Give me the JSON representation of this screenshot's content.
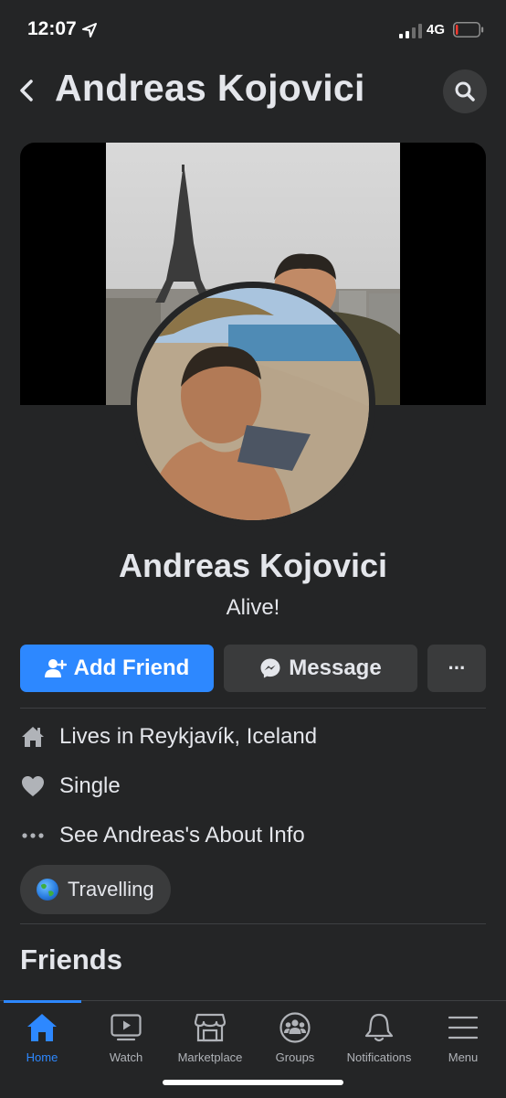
{
  "status_bar": {
    "time": "12:07",
    "network": "4G",
    "location_icon": "location-arrow-icon",
    "battery_level": 0.1,
    "battery_color": "#ff3b30"
  },
  "header": {
    "back_icon": "chevron-left-icon",
    "title": "Andreas Kojovici",
    "search_icon": "search-icon"
  },
  "profile": {
    "name": "Andreas Kojovici",
    "bio": "Alive!"
  },
  "actions": {
    "add_friend": "Add Friend",
    "message": "Message",
    "more": "···"
  },
  "intro": {
    "lives_prefix": "Lives in",
    "lives_place": "Reykjavík, Iceland",
    "relationship": "Single",
    "about": "See Andreas's About Info"
  },
  "featured_chip": {
    "emoji_icon": "globe-icon",
    "label": "Travelling"
  },
  "friends_section": {
    "title": "Friends"
  },
  "tabbar": {
    "items": [
      {
        "label": "Home",
        "icon": "home-icon",
        "active": true
      },
      {
        "label": "Watch",
        "icon": "watch-icon",
        "active": false
      },
      {
        "label": "Marketplace",
        "icon": "marketplace-icon",
        "active": false
      },
      {
        "label": "Groups",
        "icon": "groups-icon",
        "active": false
      },
      {
        "label": "Notifications",
        "icon": "bell-icon",
        "active": false
      },
      {
        "label": "Menu",
        "icon": "menu-icon",
        "active": false
      }
    ]
  },
  "colors": {
    "accent": "#2d88ff",
    "background": "#242526",
    "surface": "#3a3b3c"
  }
}
